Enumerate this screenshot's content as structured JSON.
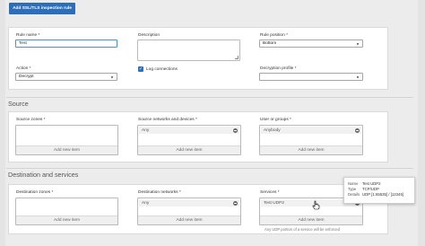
{
  "toolbar": {
    "add_rule_button": "Add SSL/TLS inspection rule"
  },
  "rule": {
    "name_label": "Rule name *",
    "name_value": "Test",
    "description_label": "Description",
    "position_label": "Rule position *",
    "position_value": "Bottom",
    "action_label": "Action *",
    "action_value": "Decrypt",
    "log_label": "Log connections",
    "log_checked": true,
    "profile_label": "Decryption profile *",
    "profile_value": ""
  },
  "source": {
    "heading": "Source",
    "zones_label": "Source zones *",
    "zones_add": "Add new item",
    "networks_label": "Source networks and devices *",
    "networks_item": "Any",
    "networks_add": "Add new item",
    "users_label": "User or groups *",
    "users_item": "Anybody",
    "users_add": "Add new item"
  },
  "destination": {
    "heading": "Destination and services",
    "zones_label": "Destination zones *",
    "zones_add": "Add new item",
    "networks_label": "Destination networks *",
    "networks_item": "Any",
    "networks_add": "Add new item",
    "services_label": "Services *",
    "services_item": "Test UDP2",
    "services_add": "Add new item",
    "services_note": "Any UDP portion of a service will be enforced"
  },
  "tooltip": {
    "name_key": "Name",
    "name_val": "Test UDP2",
    "type_key": "Type",
    "type_val": "TCP/UDP",
    "details_key": "Details",
    "details_val": "UDP [1:65535] / [12345]"
  },
  "colors": {
    "primary": "#2c6fb8",
    "panel": "#ffffff",
    "background": "#ececec"
  },
  "icons": [
    "chevron-down-icon",
    "check-icon",
    "remove-icon",
    "hand-cursor-icon"
  ]
}
